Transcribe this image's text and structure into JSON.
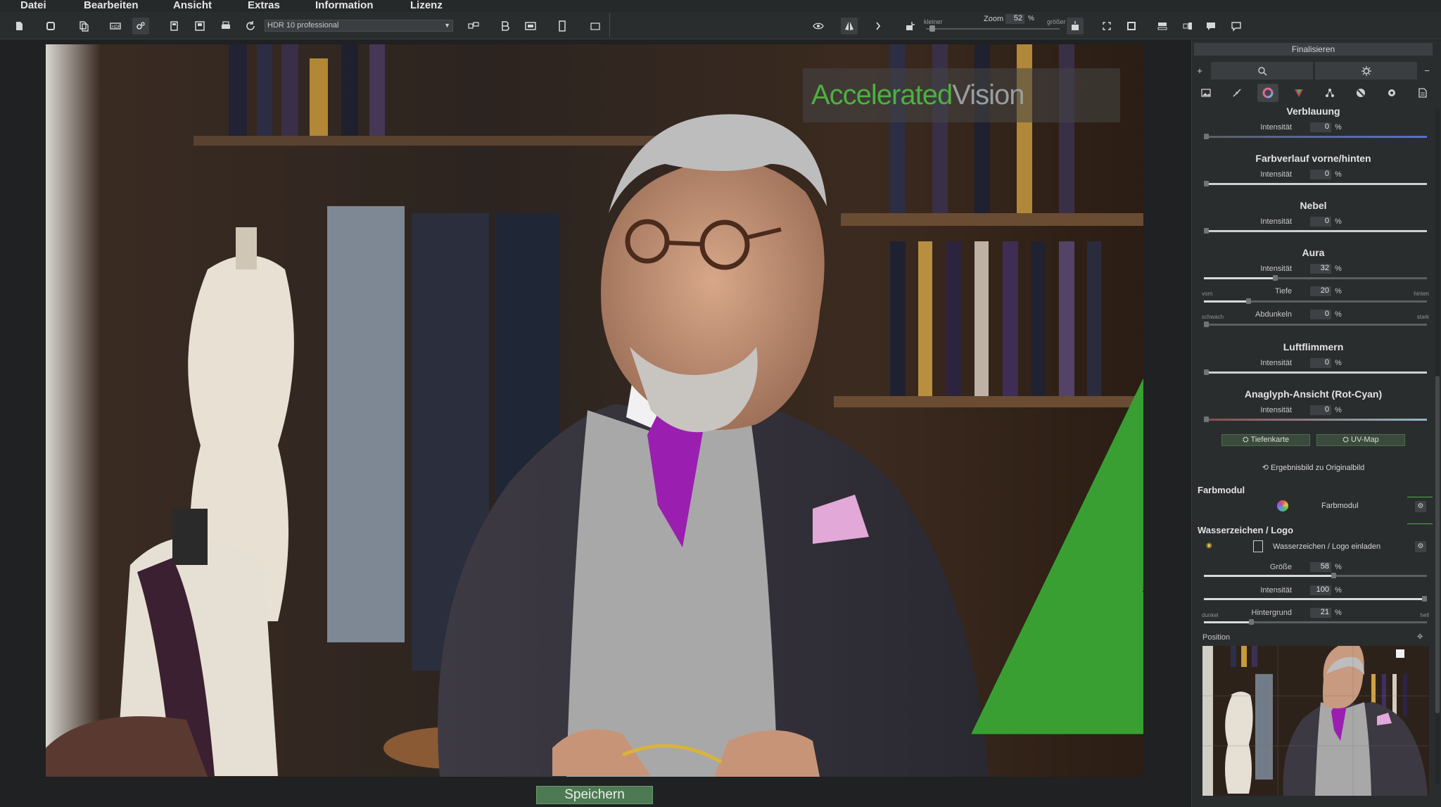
{
  "menu": {
    "items": [
      "Datei",
      "Bearbeiten",
      "Ansicht",
      "Extras",
      "Information",
      "Lizenz"
    ]
  },
  "toolbar": {
    "preset": "HDR 10 professional",
    "zoom_small_label": "kleiner",
    "zoom_label": "Zoom",
    "zoom_value": "52",
    "zoom_unit": "%",
    "zoom_big_label": "größer",
    "zoom_level_percent": 52
  },
  "watermark": {
    "brand_main": "Accelerated",
    "brand_tail": "Vision",
    "brand_color": "#4cb140"
  },
  "save_button": "Speichern",
  "panel": {
    "title": "Finalisieren",
    "tab_add": "+",
    "tab_remove": "−",
    "icons": [
      "image-icon",
      "curve-icon",
      "color-wheel-icon",
      "prism-icon",
      "nodes-icon",
      "lens-icon",
      "gear-icon",
      "document-icon"
    ],
    "sections": [
      {
        "title": "Verblauung",
        "params": [
          {
            "label": "Intensität",
            "value": "0",
            "unit": "%",
            "level": 0
          }
        ]
      },
      {
        "title": "Farbverlauf vorne/hinten",
        "params": [
          {
            "label": "Intensität",
            "value": "0",
            "unit": "%",
            "level": 0
          }
        ]
      },
      {
        "title": "Nebel",
        "params": [
          {
            "label": "Intensität",
            "value": "0",
            "unit": "%",
            "level": 0
          }
        ]
      },
      {
        "title": "Aura",
        "params": [
          {
            "label": "Intensität",
            "value": "32",
            "unit": "%",
            "level": 32
          },
          {
            "label": "Tiefe",
            "value": "20",
            "unit": "%",
            "level": 20,
            "left": "vorn",
            "right": "hinten"
          },
          {
            "label": "Abdunkeln",
            "value": "0",
            "unit": "%",
            "level": 0,
            "left": "schwach",
            "right": "stark"
          }
        ]
      },
      {
        "title": "Luftflimmern",
        "params": [
          {
            "label": "Intensität",
            "value": "0",
            "unit": "%",
            "level": 0
          }
        ]
      },
      {
        "title": "Anaglyph-Ansicht (Rot-Cyan)",
        "params": [
          {
            "label": "Intensität",
            "value": "0",
            "unit": "%",
            "level": 0
          }
        ]
      }
    ],
    "depth_map_button": "Tiefenkarte",
    "uv_map_button": "UV-Map",
    "result_link": "Ergebnisbild zu Originalbild",
    "farbmodul": {
      "heading": "Farbmodul",
      "label": "Farbmodul"
    },
    "watermark_group": {
      "heading": "Wasserzeichen / Logo",
      "load_label": "Wasserzeichen / Logo einladen",
      "params": [
        {
          "label": "Größe",
          "value": "58",
          "unit": "%",
          "level": 58
        },
        {
          "label": "Intensität",
          "value": "100",
          "unit": "%",
          "level": 100
        },
        {
          "label": "Hintergrund",
          "value": "21",
          "unit": "%",
          "level": 21,
          "left": "dunkel",
          "right": "hell"
        }
      ]
    },
    "position_label": "Position"
  }
}
